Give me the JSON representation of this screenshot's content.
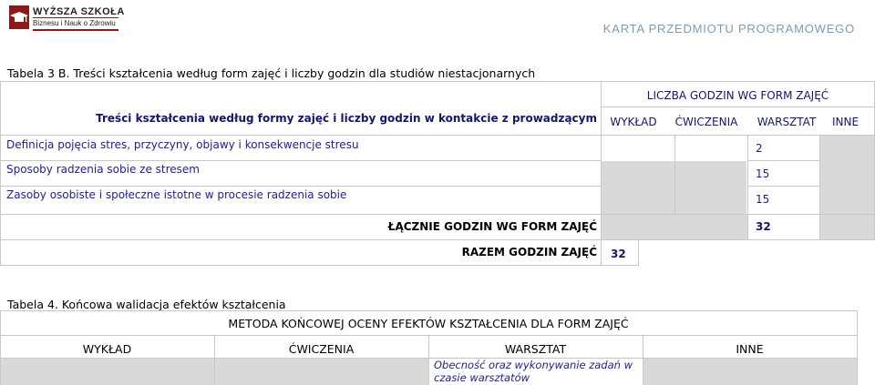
{
  "header": {
    "logo_line1": "WYŻSZA SZKOŁA",
    "logo_line2": "Biznesu i Nauk o Zdrowiu",
    "doc_title": "KARTA PRZEDMIOTU PROGRAMOWEGO"
  },
  "table3": {
    "caption": "Tabela 3 B. Treści kształcenia według form zajęć i liczby godzin dla studiów niestacjonarnych",
    "row_header": "Treści kształcenia według formy zajęć i liczby godzin w kontakcie z prowadzącym",
    "group_header": "LICZBA GODZIN WG FORM ZAJĘĆ",
    "columns": [
      "WYKŁAD",
      "ĆWICZENIA",
      "WARSZTAT",
      "INNE"
    ],
    "rows": [
      {
        "topic": "Definicja pojęcia stres, przyczyny, objawy i konsekwencje stresu",
        "warsztat": "2"
      },
      {
        "topic": "Sposoby radzenia sobie ze stresem",
        "warsztat": "15"
      },
      {
        "topic": "Zasoby osobiste i społeczne istotne w procesie radzenia sobie",
        "warsztat": "15"
      }
    ],
    "total_by_form_label": "ŁĄCZNIE GODZIN WG FORM ZAJĘĆ",
    "total_by_form_value": "32",
    "grand_total_label": "RAZEM GODZIN ZAJĘĆ",
    "grand_total_value": "32"
  },
  "table4": {
    "caption": "Tabela 4. Końcowa walidacja efektów kształcenia",
    "header": "METODA KOŃCOWEJ OCENY EFEKTÓW KSZTAŁCENIA DLA FORM ZAJĘĆ",
    "columns": [
      "WYKŁAD",
      "ĆWICZENIA",
      "WARSZTAT",
      "INNE"
    ],
    "warsztat_method": "Obecność oraz wykonywanie zadań w czasie warsztatów"
  }
}
